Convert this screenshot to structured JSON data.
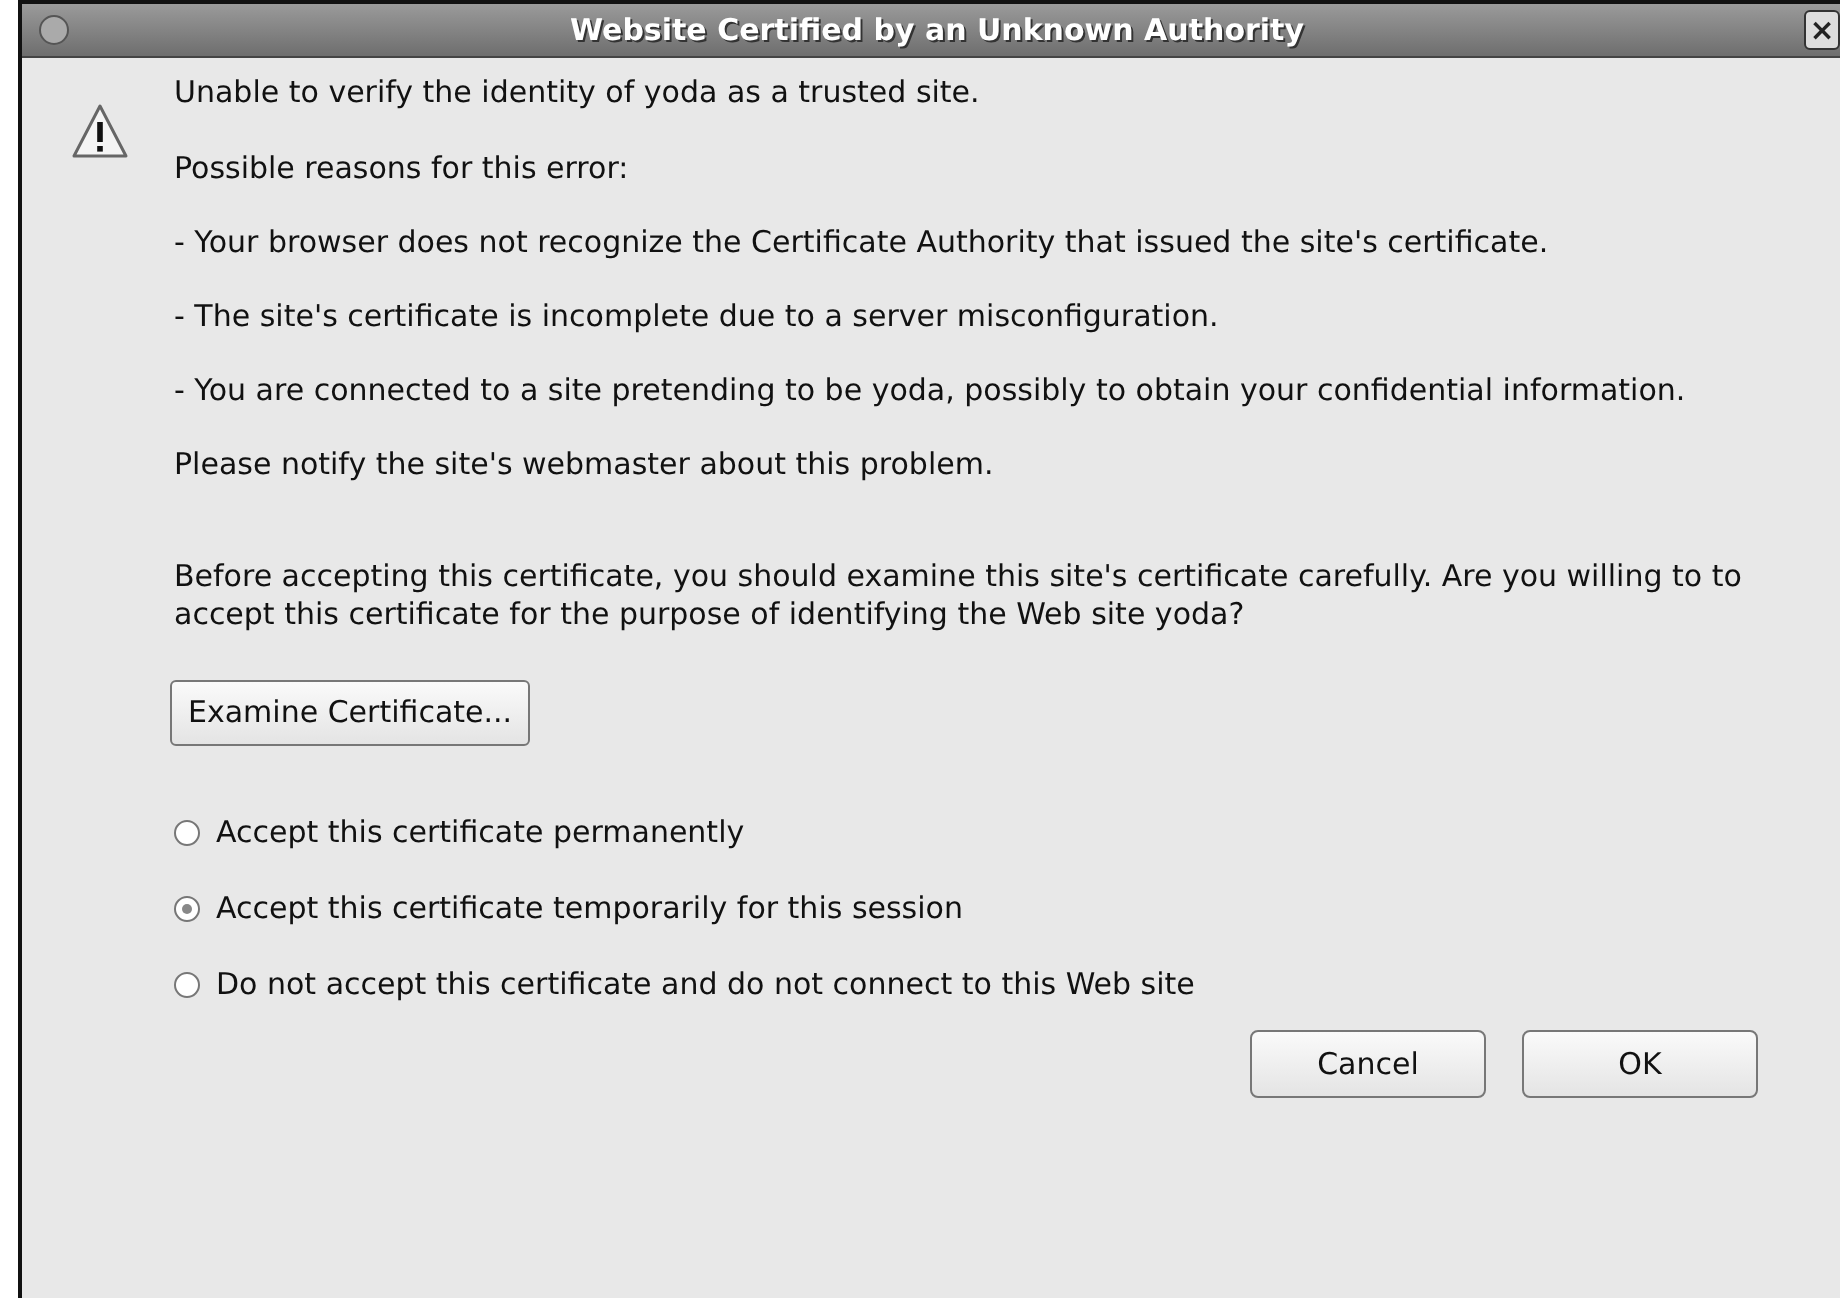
{
  "window": {
    "title": "Website Certified by an Unknown Authority",
    "close": "×"
  },
  "paragraphs": [
    {
      "kind": "lead",
      "text": "Unable to verify the identity of yoda as a trusted site."
    },
    {
      "kind": "text",
      "text": "Possible reasons for this error:"
    },
    {
      "kind": "text",
      "text": "- Your browser does not recognize the Certificate Authority that issued the site's certificate."
    },
    {
      "kind": "text",
      "text": "- The site's certificate is incomplete due to a server misconfiguration."
    },
    {
      "kind": "text",
      "text": "- You are connected to a site pretending to be yoda, possibly to obtain your confidential information."
    },
    {
      "kind": "text",
      "text": "Please notify the site's webmaster about this problem."
    },
    {
      "kind": "gap",
      "text": "Before accepting this certificate, you should examine this site's certificate carefully. Are you willing to to accept this certificate for the purpose of identifying the Web site yoda?"
    }
  ],
  "examine_button": "Examine Certificate...",
  "options": [
    {
      "label": "Accept this certificate permanently",
      "selected": false
    },
    {
      "label": "Accept this certificate temporarily for this session",
      "selected": true
    },
    {
      "label": "Do not accept this certificate and do not connect to this Web site",
      "selected": false
    }
  ],
  "buttons": [
    "Cancel",
    "OK"
  ]
}
